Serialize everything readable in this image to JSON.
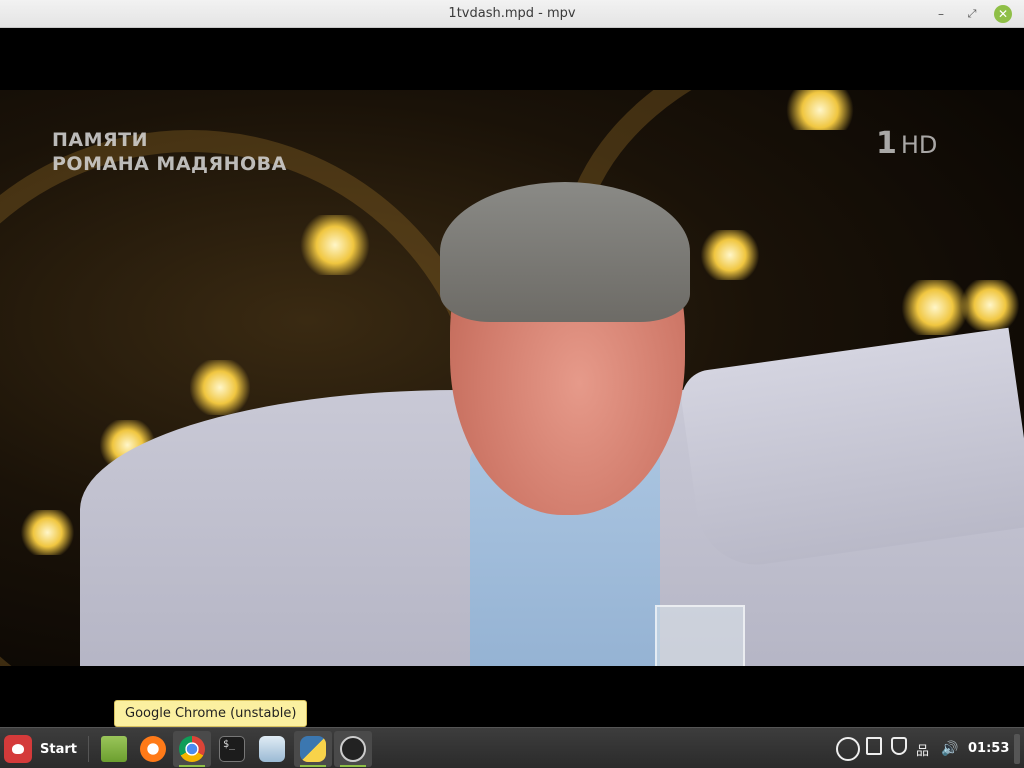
{
  "window": {
    "title": "1tvdash.mpd - mpv",
    "controls": {
      "minimize": "–",
      "maximize": "⤢",
      "close": "✕"
    }
  },
  "video": {
    "overlay_line1": "ПАМЯТИ",
    "overlay_line2": "РОМАНА МАДЯНОВА",
    "channel_number": "1",
    "channel_hd": "HD"
  },
  "tooltip": {
    "text": "Google Chrome (unstable)"
  },
  "taskbar": {
    "start_label": "Start",
    "apps": [
      {
        "name": "files-icon"
      },
      {
        "name": "firefox-icon"
      },
      {
        "name": "chrome-icon"
      },
      {
        "name": "terminal-icon",
        "glyph": "$_"
      },
      {
        "name": "mint-update-icon"
      },
      {
        "name": "python-icon"
      },
      {
        "name": "obs-icon"
      }
    ],
    "tray": {
      "network_glyph": "品",
      "volume_glyph": "🔊"
    },
    "clock": "01:53",
    "colors": {
      "accent": "#8fbf47",
      "bar": "#2b2b2b"
    }
  }
}
